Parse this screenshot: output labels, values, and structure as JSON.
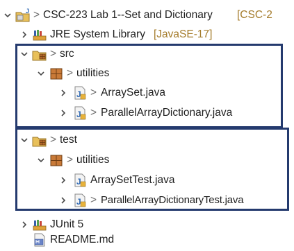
{
  "project": {
    "prefix": "> ",
    "name": "CSC-223 Lab 1--Set and Dictionary",
    "tag": "[CSC-2"
  },
  "jre": {
    "name": "JRE System Library",
    "tag": "[JavaSE-17]"
  },
  "src": {
    "prefix": "> ",
    "name": "src",
    "package": {
      "prefix": "> ",
      "name": "utilities"
    },
    "files": [
      {
        "prefix": "> ",
        "name": "ArraySet.java"
      },
      {
        "prefix": "> ",
        "name": "ParallelArrayDictionary.java"
      }
    ]
  },
  "test": {
    "prefix": "> ",
    "name": "test",
    "package": {
      "prefix": "> ",
      "name": "utilities"
    },
    "files": [
      {
        "prefix": "",
        "name": "ArraySetTest.java"
      },
      {
        "prefix": "> ",
        "name": "ParallelArrayDictionaryTest.java"
      }
    ]
  },
  "junit": {
    "name": "JUnit 5"
  },
  "readme": {
    "name": "README.md"
  },
  "colors": {
    "highlight_border": "#243a6e",
    "decorator_tag": "#a47b2a"
  }
}
